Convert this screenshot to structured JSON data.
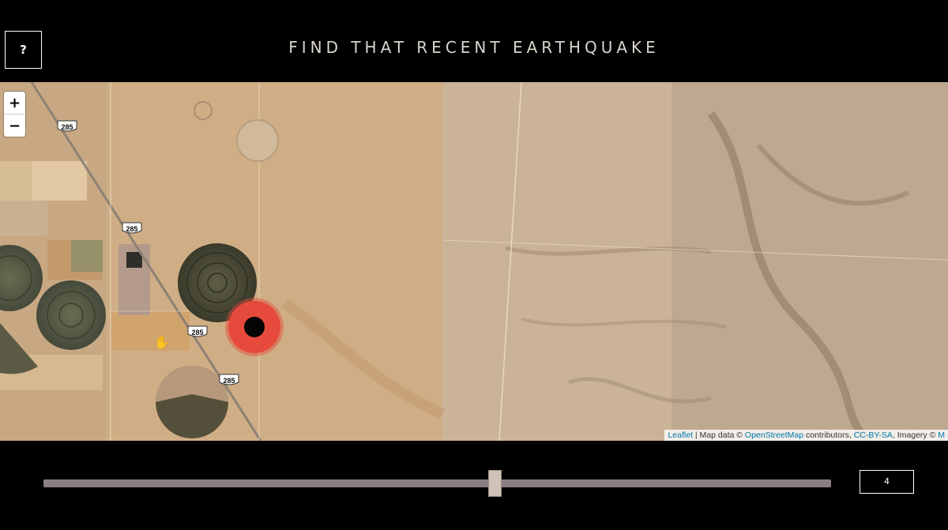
{
  "header": {
    "help_label": "?",
    "title": "FIND THAT RECENT EARTHQUAKE"
  },
  "map": {
    "zoom_in_label": "+",
    "zoom_out_label": "−",
    "route_shields": [
      "285",
      "285",
      "285",
      "285"
    ],
    "marker_color": "#e64a3c",
    "marker_core_color": "#050505",
    "attribution": {
      "leaflet": "Leaflet",
      "sep": " | Map data © ",
      "osm": "OpenStreetMap",
      "contributors": " contributors, ",
      "license": "CC-BY-SA",
      "imagery": ", Imagery © ",
      "imagery_source": "M"
    }
  },
  "slider": {
    "value": "4",
    "fraction": 0.573,
    "track_color": "#8b7f83",
    "thumb_color": "#cfc3b5"
  },
  "icons": {
    "help": "question-icon",
    "zoom_in": "plus-icon",
    "zoom_out": "minus-icon",
    "cursor": "hand-cursor-icon",
    "marker": "earthquake-marker-icon"
  }
}
